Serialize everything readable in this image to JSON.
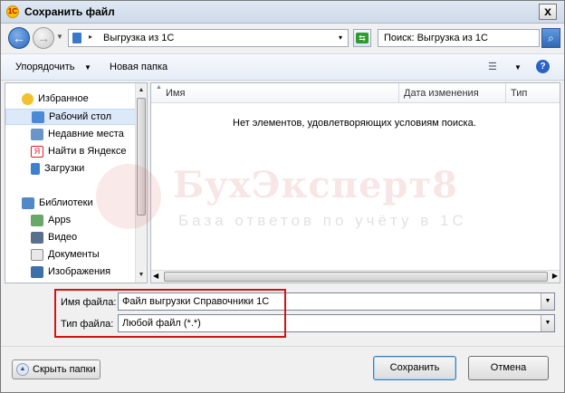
{
  "window": {
    "title": "Сохранить файл",
    "app_icon": "1c-icon",
    "close_label": "x"
  },
  "address_bar": {
    "breadcrumb_sep": "▸",
    "path": "Выгрузка из 1С",
    "dropdown": "▾"
  },
  "search": {
    "value": "Поиск: Выгрузка из 1С"
  },
  "toolbar": {
    "organize_label": "Упорядочить",
    "new_folder_label": "Новая папка",
    "help_label": "?"
  },
  "navigation": {
    "favorites": {
      "label": "Избранное",
      "items": [
        {
          "label": "Рабочий стол",
          "icon": "desktop-icon",
          "selected": true
        },
        {
          "label": "Недавние места",
          "icon": "recent-places-icon"
        },
        {
          "label": "Найти в Яндексе",
          "icon": "yandex-icon"
        },
        {
          "label": "Загрузки",
          "icon": "downloads-icon"
        }
      ]
    },
    "libraries": {
      "label": "Библиотеки",
      "items": [
        {
          "label": "Apps",
          "icon": "apps-icon"
        },
        {
          "label": "Видео",
          "icon": "video-icon"
        },
        {
          "label": "Документы",
          "icon": "documents-icon"
        },
        {
          "label": "Изображения",
          "icon": "images-icon"
        }
      ]
    }
  },
  "file_list": {
    "columns": [
      "Имя",
      "Дата изменения",
      "Тип"
    ],
    "empty_message": "Нет элементов, удовлетворяющих условиям поиска."
  },
  "watermark": {
    "title": "БухЭксперт8",
    "subtitle": "База ответов по учёту в 1С"
  },
  "form": {
    "filename_label": "Имя файла:",
    "filename_value": "Файл выгрузки Справочники 1С",
    "filetype_label": "Тип файла:",
    "filetype_value": "Любой файл (*.*)"
  },
  "footer": {
    "hide_folders_label": "Скрыть папки",
    "save_label": "Сохранить",
    "cancel_label": "Отмена"
  },
  "colors": {
    "highlight": "#d31414",
    "selection": "#dce9f9",
    "accent": "#2a68c0"
  }
}
